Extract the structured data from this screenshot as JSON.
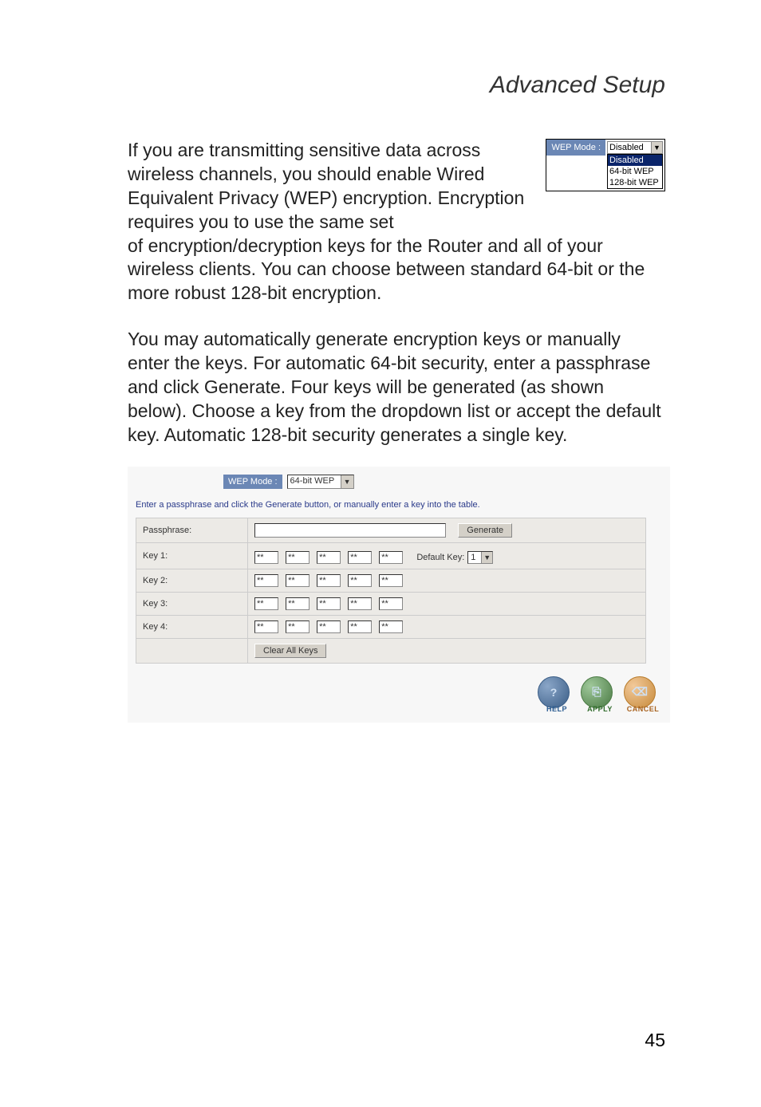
{
  "header": {
    "title": "Advanced Setup"
  },
  "paragraph1_left": "If you are transmitting sensitive data across wireless channels, you should enable Wired Equivalent Privacy (WEP) encryption. Encryption requires you to use the same set",
  "paragraph1_rest": "of encryption/decryption keys for the Router and all of your wireless clients. You can choose between standard 64-bit or the more robust 128-bit encryption.",
  "paragraph2": "You may automatically generate encryption keys or manually enter the keys. For automatic 64-bit security, enter a passphrase and click Generate. Four keys will be generated (as shown below). Choose a key from the dropdown list or accept the default key. Automatic 128-bit security generates a single key.",
  "mini_widget": {
    "label": "WEP Mode :",
    "selected": "Disabled",
    "options": [
      "Disabled",
      "64-bit WEP",
      "128-bit WEP"
    ]
  },
  "shot": {
    "mode_label": "WEP Mode :",
    "mode_value": "64-bit WEP",
    "instruction": "Enter a passphrase and click the Generate button, or manually enter a key into the table.",
    "rows": {
      "passphrase_label": "Passphrase:",
      "passphrase_value": "",
      "generate_label": "Generate",
      "default_label": "Default",
      "key_select_label": "Key:",
      "key_select_value": "1",
      "key1_label": "Key 1:",
      "key2_label": "Key 2:",
      "key3_label": "Key 3:",
      "key4_label": "Key 4:",
      "mask": "**",
      "clear_label": "Clear All Keys"
    }
  },
  "footer": {
    "help": "HELP",
    "apply": "APPLY",
    "cancel": "CANCEL",
    "help_icon": "?",
    "apply_icon": "⎘",
    "cancel_icon": "⌫"
  },
  "page_number": "45"
}
